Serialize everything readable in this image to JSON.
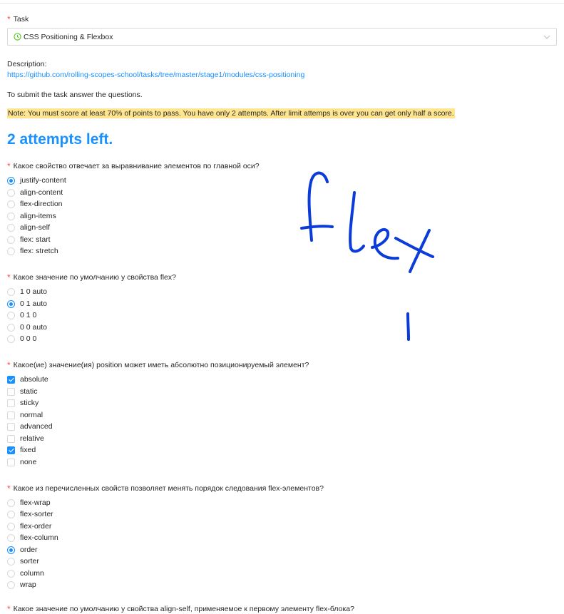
{
  "task": {
    "label": "Task",
    "selected": "CSS Positioning & Flexbox"
  },
  "description": {
    "label": "Description:",
    "link": "https://github.com/rolling-scopes-school/tasks/tree/master/stage1/modules/css-positioning",
    "instruction": "To submit the task answer the questions.",
    "note": "Note: You must score at least 70% of points to pass. You have only 2 attempts. After limit attemps is over you can get only half a score."
  },
  "attempts_left": "2 attempts left.",
  "questions": [
    {
      "text": "Какое свойство отвечает за выравнивание элементов по главной оси?",
      "type": "radio",
      "options": [
        {
          "label": "justify-content",
          "checked": true
        },
        {
          "label": "align-content",
          "checked": false
        },
        {
          "label": "flex-direction",
          "checked": false
        },
        {
          "label": "align-items",
          "checked": false
        },
        {
          "label": "align-self",
          "checked": false
        },
        {
          "label": "flex: start",
          "checked": false
        },
        {
          "label": "flex: stretch",
          "checked": false
        }
      ]
    },
    {
      "text": "Какое значение по умолчанию у свойства flex?",
      "type": "radio",
      "options": [
        {
          "label": "1 0 auto",
          "checked": false
        },
        {
          "label": "0 1 auto",
          "checked": true
        },
        {
          "label": "0 1 0",
          "checked": false
        },
        {
          "label": "0 0 auto",
          "checked": false
        },
        {
          "label": "0 0 0",
          "checked": false
        }
      ]
    },
    {
      "text": "Какое(ие) значение(ия) position может иметь абсолютно позиционируемый элемент?",
      "type": "checkbox",
      "options": [
        {
          "label": "absolute",
          "checked": true
        },
        {
          "label": "static",
          "checked": false
        },
        {
          "label": "sticky",
          "checked": false
        },
        {
          "label": "normal",
          "checked": false
        },
        {
          "label": "advanced",
          "checked": false
        },
        {
          "label": "relative",
          "checked": false
        },
        {
          "label": "fixed",
          "checked": true
        },
        {
          "label": "none",
          "checked": false
        }
      ]
    },
    {
      "text": "Какое из перечисленных свойств позволяет менять порядок следования flex-элементов?",
      "type": "radio",
      "options": [
        {
          "label": "flex-wrap",
          "checked": false
        },
        {
          "label": "flex-sorter",
          "checked": false
        },
        {
          "label": "flex-order",
          "checked": false
        },
        {
          "label": "flex-column",
          "checked": false
        },
        {
          "label": "order",
          "checked": true
        },
        {
          "label": "sorter",
          "checked": false
        },
        {
          "label": "column",
          "checked": false
        },
        {
          "label": "wrap",
          "checked": false
        }
      ]
    },
    {
      "text": "Какое значение по умолчанию у свойства align-self, применяемое к первому элементу flex-блока?",
      "type": "radio",
      "options": []
    }
  ],
  "annotation": {
    "handwritten": "flex",
    "mark": "|",
    "ink_color": "#0b3bd9"
  },
  "colors": {
    "accent": "#1890ff",
    "required": "#ff4d4f",
    "highlight": "#ffe58f",
    "success": "#52c41a"
  }
}
